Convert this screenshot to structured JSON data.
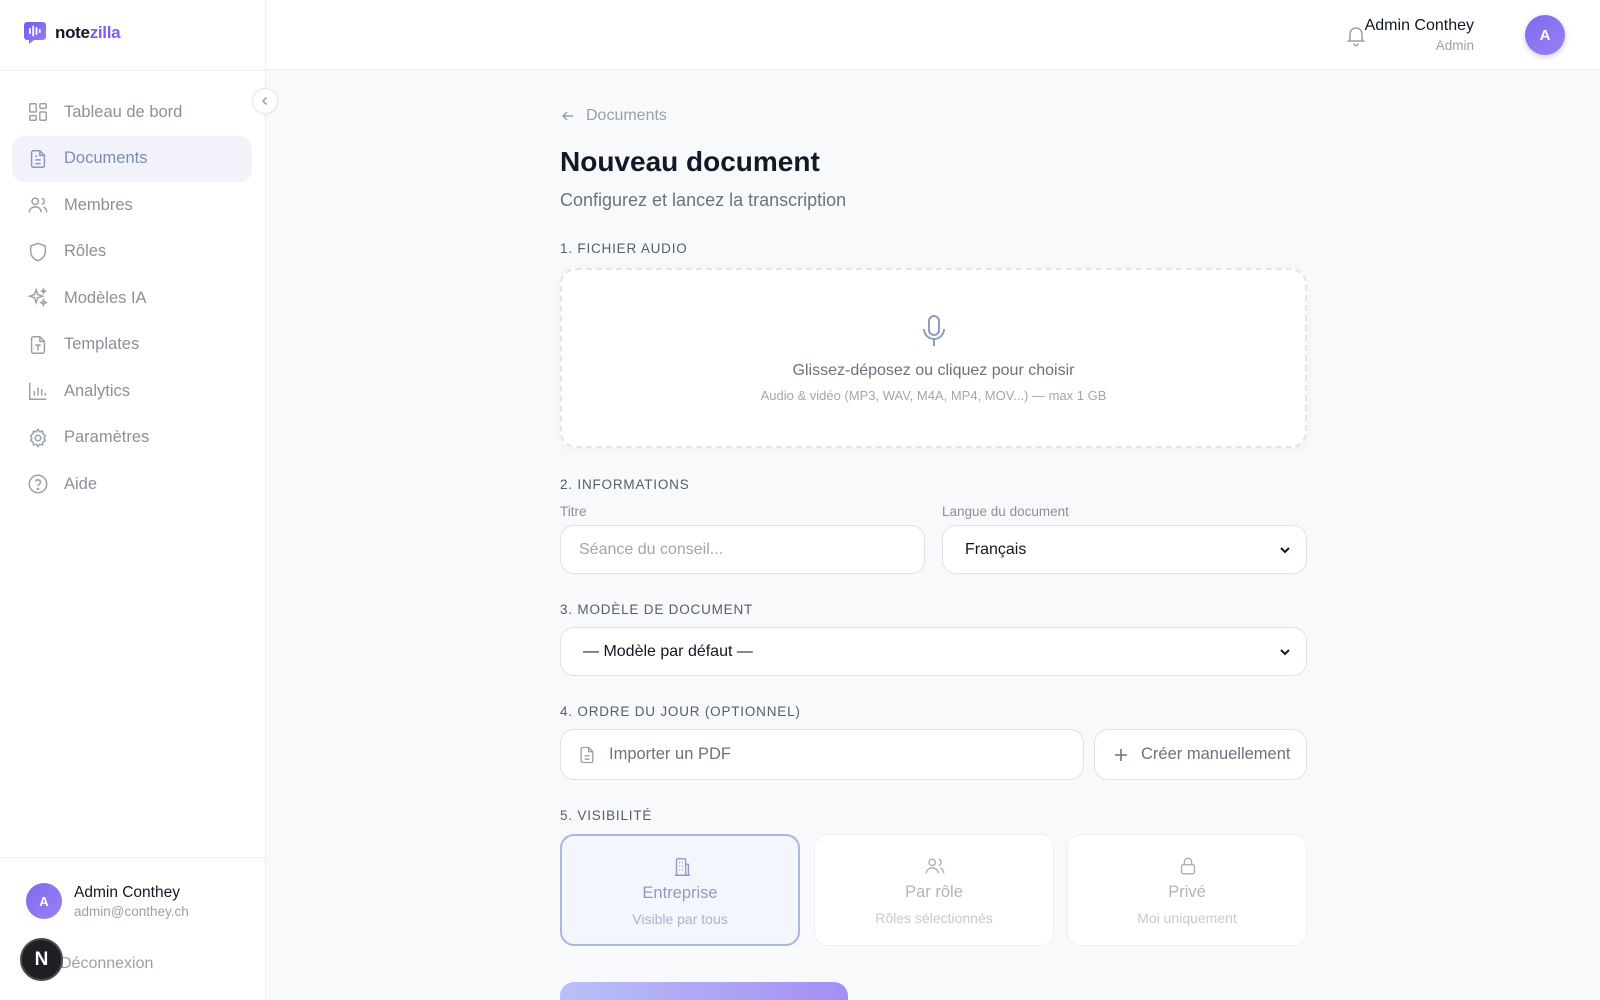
{
  "app": {
    "logo_name_dark": "note",
    "logo_name_accent": "zilla",
    "colors": {
      "accent": "#7c5cf0",
      "active_nav_bg": "#f2f3fa",
      "selected_card_border": "#a9b7e6"
    }
  },
  "sidebar": {
    "items": [
      {
        "label": "Tableau de bord",
        "icon": "dashboard-icon"
      },
      {
        "label": "Documents",
        "icon": "document-icon",
        "active": true
      },
      {
        "label": "Membres",
        "icon": "users-icon"
      },
      {
        "label": "Rôles",
        "icon": "shield-icon"
      },
      {
        "label": "Modèles IA",
        "icon": "sparkles-icon"
      },
      {
        "label": "Templates",
        "icon": "template-icon"
      },
      {
        "label": "Analytics",
        "icon": "bar-chart-icon"
      },
      {
        "label": "Paramètres",
        "icon": "gear-icon"
      },
      {
        "label": "Aide",
        "icon": "help-icon"
      }
    ],
    "user": {
      "initial": "A",
      "name": "Admin Conthey",
      "email": "admin@conthey.ch"
    },
    "logout_label": "Déconnexion",
    "badge_letter": "N"
  },
  "header": {
    "user_name": "Admin Conthey",
    "user_role": "Admin",
    "avatar_initial": "A"
  },
  "main": {
    "back_label": "Documents",
    "title": "Nouveau document",
    "subtitle": "Configurez et lancez la transcription",
    "sections": {
      "audio": "1. FICHIER AUDIO",
      "info": "2. INFORMATIONS",
      "model": "3. MODÈLE DE DOCUMENT",
      "agenda": "4. ORDRE DU JOUR (OPTIONNEL)",
      "visibility": "5. VISIBILITÉ"
    },
    "dropzone": {
      "title": "Glissez-déposez ou cliquez pour choisir",
      "subtitle": "Audio & vidéo (MP3, WAV, M4A, MP4, MOV...) — max 1 GB"
    },
    "title_field": {
      "label": "Titre",
      "value": "",
      "placeholder": "Séance du conseil..."
    },
    "language_field": {
      "label": "Langue du document",
      "selected": "Français"
    },
    "model_select": {
      "selected": "— Modèle par défaut —"
    },
    "agenda": {
      "import_label": "Importer un PDF",
      "create_label": "Créer manuellement"
    },
    "visibility_options": [
      {
        "title": "Entreprise",
        "subtitle": "Visible par tous",
        "icon": "building-icon",
        "selected": true
      },
      {
        "title": "Par rôle",
        "subtitle": "Rôles sélectionnés",
        "icon": "users-icon",
        "selected": false
      },
      {
        "title": "Privé",
        "subtitle": "Moi uniquement",
        "icon": "lock-icon",
        "selected": false
      }
    ]
  }
}
